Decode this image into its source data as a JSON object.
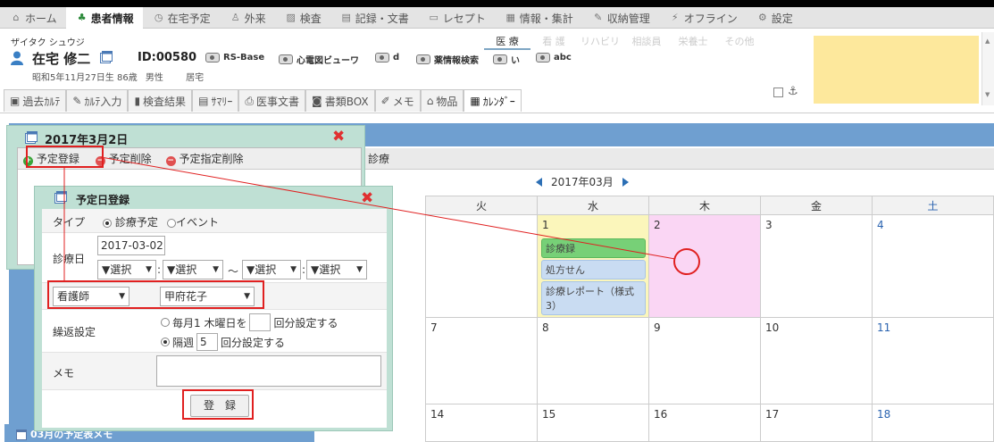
{
  "nav": {
    "tabs": [
      {
        "label": "ホーム",
        "icon": "home-icon"
      },
      {
        "label": "患者情報",
        "icon": "patient-icon",
        "active": true
      },
      {
        "label": "在宅予定",
        "icon": "clock-icon"
      },
      {
        "label": "外来",
        "icon": "person-icon"
      },
      {
        "label": "検査",
        "icon": "image-icon"
      },
      {
        "label": "記録・文書",
        "icon": "document-icon"
      },
      {
        "label": "レセプト",
        "icon": "receipt-icon"
      },
      {
        "label": "情報・集計",
        "icon": "chart-icon"
      },
      {
        "label": "収納管理",
        "icon": "pen-icon"
      },
      {
        "label": "オフライン",
        "icon": "plug-icon"
      },
      {
        "label": "設定",
        "icon": "gear-icon"
      }
    ]
  },
  "patient": {
    "kana": "ザイタク シュウジ",
    "name": "在宅 修二",
    "id": "ID:00580",
    "birth": "昭和5年11月27日生 86歳",
    "sex": "男性",
    "status": "居宅",
    "links": [
      "RS-Base",
      "心電図ビューワ",
      "d",
      "薬情報検索",
      "い",
      "abc"
    ],
    "subtabs": [
      "医 療",
      "看 護",
      "リハビリ",
      "相談員",
      "栄養士",
      "その他"
    ]
  },
  "karte_tabs": [
    {
      "label": "過去ｶﾙﾃ",
      "icon": "history-icon"
    },
    {
      "label": "ｶﾙﾃ入力",
      "icon": "edit-icon"
    },
    {
      "label": "検査結果",
      "icon": "bar-chart-icon"
    },
    {
      "label": "ｻﾏﾘｰ",
      "icon": "summary-icon"
    },
    {
      "label": "医事文書",
      "icon": "pdf-icon"
    },
    {
      "label": "書類BOX",
      "icon": "box-icon"
    },
    {
      "label": "メモ",
      "icon": "memo-icon"
    },
    {
      "label": "物品",
      "icon": "goods-icon"
    },
    {
      "label": "ｶﾚﾝﾀﾞｰ",
      "icon": "calendar-icon",
      "active": true
    }
  ],
  "calendar": {
    "tab_label": "診療",
    "month": "2017年03月",
    "weekdays": [
      "火",
      "水",
      "木",
      "金",
      "土"
    ],
    "rows": [
      [
        "",
        "1",
        "2",
        "3",
        "4"
      ],
      [
        "7",
        "8",
        "9",
        "10",
        "11"
      ],
      [
        "14",
        "15",
        "16",
        "17",
        "18"
      ]
    ],
    "events": [
      "診療録",
      "処方せん",
      "診療レポート（様式3）"
    ],
    "plan_memo": "03月の予定表メモ"
  },
  "dialog_day": {
    "title": "2017年3月2日",
    "add": "予定登録",
    "delete": "予定削除",
    "delete_specified": "予定指定削除"
  },
  "dialog_register": {
    "title": "予定日登録",
    "type_label": "タイプ",
    "type_options": [
      "診療予定",
      "イベント"
    ],
    "date_label": "診療日",
    "date_value": "2017-03-02",
    "select_text": "▼選択",
    "tilde": "～",
    "colon": ":",
    "staff_role": "看護師",
    "staff_name": "甲府花子",
    "repeat_label": "繰返設定",
    "repeat_opt1_a": "毎月1 木曜日を",
    "repeat_opt1_b": "回分設定する",
    "repeat_opt2_a": "隔週",
    "repeat_opt2_value": "5",
    "repeat_opt2_b": "回分設定する",
    "memo_label": "メモ",
    "submit": "登　録"
  },
  "colors": {
    "accent_blue": "#6f9fd0",
    "dialog_green": "#bfe0d4",
    "highlight_red": "#e02020",
    "event_green": "#77d077",
    "event_blue": "#c9dcf2",
    "today_pink": "#fad6f4",
    "selected_yellow": "#fbf6bb"
  }
}
